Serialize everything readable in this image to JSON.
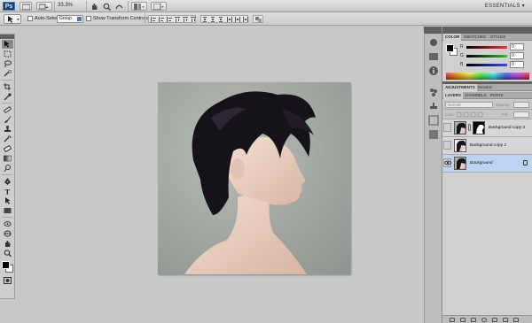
{
  "appbar": {
    "logo": "Ps",
    "zoom": "33.3%",
    "workspace": "ESSENTIALS ▾"
  },
  "options": {
    "auto_select_label": "Auto-Select:",
    "auto_select_value": "Group",
    "transform_label": "Show Transform Controls"
  },
  "color_panel": {
    "tabs": [
      "COLOR",
      "SWATCHES",
      "STYLES"
    ],
    "sliders": [
      {
        "label": "R",
        "value": "0",
        "color": "#ff3030"
      },
      {
        "label": "G",
        "value": "0",
        "color": "#30c030"
      },
      {
        "label": "B",
        "value": "0",
        "color": "#3050ff"
      }
    ]
  },
  "adjust_panel": {
    "tabs": [
      "ADJUSTMENTS",
      "MASKS"
    ]
  },
  "layers_panel": {
    "tabs": [
      "LAYERS",
      "CHANNELS",
      "PATHS"
    ],
    "blend_mode": "Normal",
    "opacity_label": "Opacity:",
    "lock_label": "Lock:",
    "fill_label": "Fill:",
    "layers": [
      {
        "name": "Background copy 3",
        "has_mask": true,
        "visible": false,
        "active": false
      },
      {
        "name": "Background copy 2",
        "has_mask": false,
        "visible": false,
        "active": false
      },
      {
        "name": "Background",
        "has_mask": false,
        "visible": true,
        "active": true
      }
    ]
  },
  "colors": {
    "workspace_bg": "#c8c8c8",
    "panel_bg": "#d0d0d0",
    "active_layer": "#bcd3f4",
    "photo_bg": "#9ea39e"
  }
}
